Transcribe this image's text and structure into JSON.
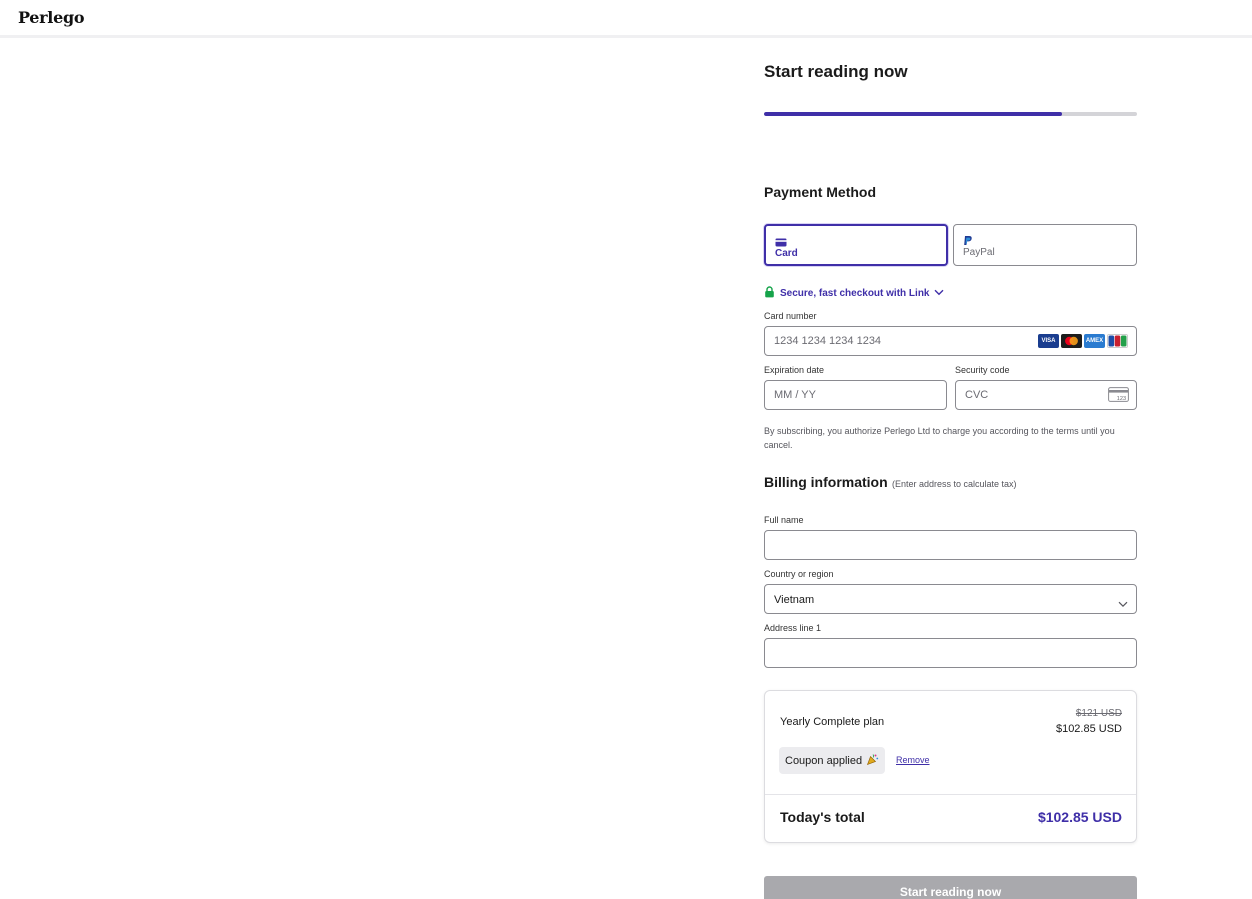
{
  "brand": {
    "logo_text": "Perlego"
  },
  "checkout": {
    "title": "Start reading now",
    "progress": 0.8
  },
  "payment": {
    "section_title": "Payment Method",
    "tabs": [
      {
        "label": "Card",
        "icon": "card-icon",
        "selected": true
      },
      {
        "label": "PayPal",
        "icon": "paypal-icon",
        "selected": false
      }
    ],
    "link_text": "Secure, fast checkout with Link",
    "card_number": {
      "label": "Card number",
      "placeholder": "1234 1234 1234 1234"
    },
    "card_brands": [
      "VISA",
      "Mastercard",
      "AMEX",
      "JCB"
    ],
    "expiration": {
      "label": "Expiration date",
      "placeholder": "MM / YY"
    },
    "security": {
      "label": "Security code",
      "placeholder": "CVC",
      "icon_text": "123"
    },
    "terms": "By subscribing, you authorize Perlego Ltd to charge you according to the terms until you cancel."
  },
  "billing": {
    "title": "Billing information",
    "note": "(Enter address to calculate tax)",
    "full_name": {
      "label": "Full name",
      "value": ""
    },
    "country": {
      "label": "Country or region",
      "value": "Vietnam"
    },
    "address1": {
      "label": "Address line 1",
      "value": ""
    }
  },
  "summary": {
    "plan_name": "Yearly Complete plan",
    "old_price": "$121 USD",
    "new_price": "$102.85 USD",
    "coupon_text": "Coupon applied",
    "remove_label": "Remove",
    "total_label": "Today's total",
    "total_value": "$102.85 USD"
  },
  "submit": {
    "label": "Start reading now"
  },
  "colors": {
    "accent": "#3f2fa8",
    "link_lock": "#16a34a",
    "button_disabled": "#a9a9ad"
  }
}
